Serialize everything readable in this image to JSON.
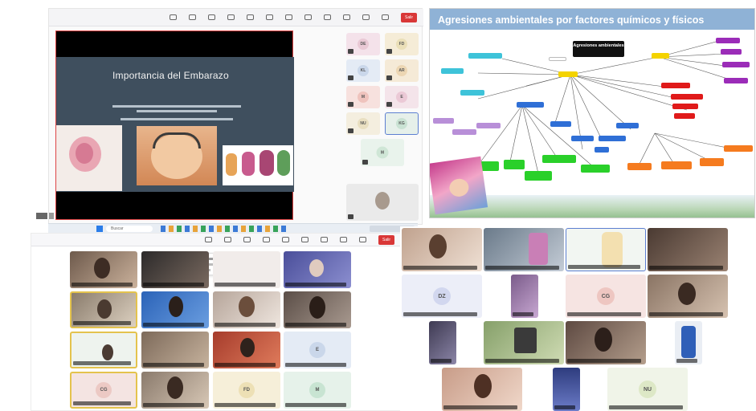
{
  "top_left_call": {
    "toolbar": {
      "buttons": [
        "",
        "",
        "",
        "",
        "",
        "",
        "",
        "",
        "",
        "",
        "",
        ""
      ],
      "leave_label": "Salir"
    },
    "slide": {
      "title": "Importancia del Embarazo",
      "line1": "",
      "line2": "",
      "image_caption": ""
    },
    "participants": [
      {
        "initials": "DE"
      },
      {
        "initials": "FD"
      },
      {
        "initials": "KL"
      },
      {
        "initials": "AR"
      },
      {
        "initials": "M"
      },
      {
        "initials": "E"
      },
      {
        "initials": "NU"
      },
      {
        "initials": "KG"
      },
      {
        "initials": "M"
      }
    ]
  },
  "taskbar": {
    "search_placeholder": "Buscar",
    "time": ""
  },
  "concept_map": {
    "title": "Agresiones ambientales por factores químicos y físicos",
    "center_label": "Agresiones ambientales",
    "colors": {
      "header": "#8fb2d6",
      "title_text": "#ffffff",
      "cyan": "#3ec3d9",
      "blue": "#2f6fd6",
      "green": "#2ad02a",
      "yellow": "#f4d300",
      "orange": "#f57b1f",
      "red": "#e01a1a",
      "purple": "#9b2cb8",
      "lavender": "#b88fd8"
    }
  },
  "bottom_left_call": {
    "toolbar": {
      "leave_label": "Salir"
    },
    "notification": {
      "title": "",
      "body": ""
    },
    "participants": [
      {
        "initials": "E"
      },
      {
        "initials": "CG"
      },
      {
        "initials": "FD"
      },
      {
        "initials": "M"
      }
    ]
  },
  "bottom_right_call": {
    "participants": [
      {
        "initials": "DZ"
      },
      {
        "initials": "CG"
      },
      {
        "initials": "NU"
      }
    ]
  }
}
